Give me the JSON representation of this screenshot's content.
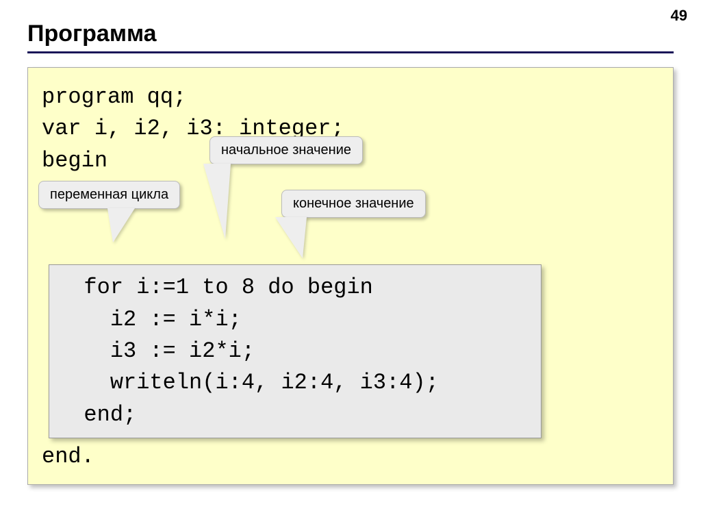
{
  "page_number": "49",
  "title": "Программа",
  "code": {
    "line1": "program qq;",
    "line2": "var i, i2, i3: integer;",
    "line3": "begin",
    "inner": "  for i:=1 to 8 do begin\n    i2 := i*i;\n    i3 := i2*i;\n    writeln(i:4, i2:4, i3:4);\n  end;",
    "line_last": "end."
  },
  "callouts": {
    "loop_variable": "переменная цикла",
    "initial_value": "начальное значение",
    "final_value": "конечное значение"
  }
}
